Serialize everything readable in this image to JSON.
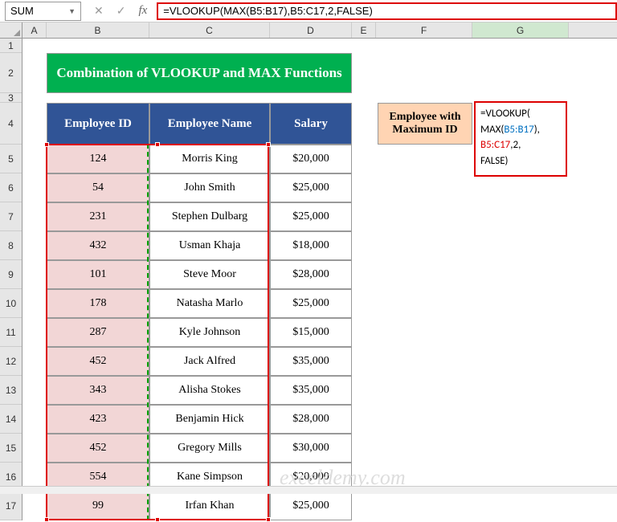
{
  "nameBox": "SUM",
  "formulaBar": "=VLOOKUP(MAX(B5:B17),B5:C17,2,FALSE)",
  "columns": [
    "A",
    "B",
    "C",
    "D",
    "E",
    "F",
    "G"
  ],
  "rows": [
    "1",
    "2",
    "3",
    "4",
    "5",
    "6",
    "7",
    "8",
    "9",
    "10",
    "11",
    "12",
    "13",
    "14",
    "15",
    "16",
    "17"
  ],
  "title": "Combination of VLOOKUP and MAX Functions",
  "headers": {
    "col1": "Employee ID",
    "col2": "Employee Name",
    "col3": "Salary"
  },
  "data": [
    {
      "id": "124",
      "name": "Morris King",
      "salary": "$20,000"
    },
    {
      "id": "54",
      "name": "John Smith",
      "salary": "$25,000"
    },
    {
      "id": "231",
      "name": "Stephen Dulbarg",
      "salary": "$25,000"
    },
    {
      "id": "432",
      "name": "Usman Khaja",
      "salary": "$18,000"
    },
    {
      "id": "101",
      "name": "Steve Moor",
      "salary": "$28,000"
    },
    {
      "id": "178",
      "name": "Natasha Marlo",
      "salary": "$25,000"
    },
    {
      "id": "287",
      "name": "Kyle Johnson",
      "salary": "$15,000"
    },
    {
      "id": "452",
      "name": "Jack Alfred",
      "salary": "$35,000"
    },
    {
      "id": "343",
      "name": "Alisha Stokes",
      "salary": "$35,000"
    },
    {
      "id": "423",
      "name": "Benjamin Hick",
      "salary": "$28,000"
    },
    {
      "id": "452",
      "name": "Gregory Mills",
      "salary": "$30,000"
    },
    {
      "id": "554",
      "name": "Kane Simpson",
      "salary": "$20,000"
    },
    {
      "id": "99",
      "name": "Irfan Khan",
      "salary": "$25,000"
    }
  ],
  "sideLabel": "Employee with Maximum ID",
  "formulaDisplay": {
    "line1a": "=VLOOKUP(",
    "line2a": "MAX(",
    "line2b": "B5:B17",
    "line2c": "),",
    "line3a": "B5:C17",
    "line3b": ",2,",
    "line4": "FALSE)"
  },
  "watermark": "exceldemy.com"
}
